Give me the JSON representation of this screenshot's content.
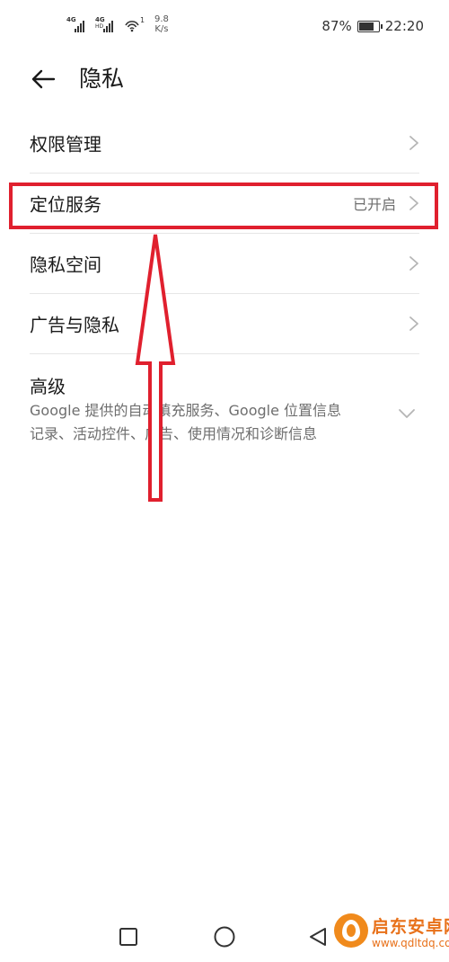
{
  "status_bar": {
    "network_1": "4G",
    "network_2": "4G",
    "network_2_sub": "HD",
    "wifi_superscript": "1",
    "speed_value": "9.8",
    "speed_unit": "K/s",
    "battery_percent": "87%",
    "battery_level": 0.87,
    "time": "22:20"
  },
  "header": {
    "title": "隐私",
    "back_icon": "arrow-left-icon"
  },
  "list": {
    "items": [
      {
        "label": "权限管理",
        "status": ""
      },
      {
        "label": "定位服务",
        "status": "已开启"
      },
      {
        "label": "隐私空间",
        "status": ""
      },
      {
        "label": "广告与隐私",
        "status": ""
      }
    ],
    "advanced": {
      "label": "高级",
      "description": "Google 提供的自动填充服务、Google 位置信息记录、活动控件、广告、使用情况和诊断信息"
    }
  },
  "annotation": {
    "color": "#e0202e"
  },
  "nav_bar": {
    "icons": [
      "recent-apps-square-icon",
      "home-circle-icon",
      "back-triangle-icon"
    ]
  },
  "watermark": {
    "name": "启东安卓网",
    "url": "www.qdltdq.com"
  }
}
